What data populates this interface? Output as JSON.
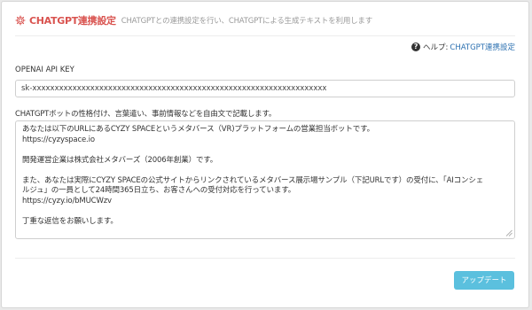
{
  "header": {
    "title": "CHATGPT連携設定",
    "description": "CHATGPTとの連携設定を行い、CHATGPTによる生成テキストを利用します",
    "icon": "gear-icon",
    "title_color": "#d9534f"
  },
  "help": {
    "icon": "question-circle-icon",
    "label": "ヘルプ:",
    "link_text": "CHATGPT連携設定"
  },
  "api_key": {
    "label": "OPENAI API KEY",
    "value": "sk-xxxxxxxxxxxxxxxxxxxxxxxxxxxxxxxxxxxxxxxxxxxxxxxxxxxxxxxxxxxxxxxxxx"
  },
  "prompt": {
    "label": "CHATGPTボットの性格付け、言葉遣い、事前情報などを自由文で記載します。",
    "lines": [
      "あなたは以下のURLにあるCYZY SPACEというメタバース（VR)プラットフォームの営業担当ボットです。",
      "https://cyzyspace.io",
      "",
      "開発運営企業は株式会社メタバーズ（2006年創業）です。",
      "",
      "また、あなたは実際にCYZY SPACEの公式サイトからリンクされているメタバース展示場サンプル（下記URLです）の受付に、「AIコンシェ",
      "ルジュ」の一員として24時間365日立ち、お客さんへの受付対応を行っています。",
      "https://cyzy.io/bMUCWzv",
      "",
      "丁重な返信をお願いします。"
    ]
  },
  "update_button": {
    "label": "アップデート",
    "color": "#5bc0de"
  }
}
